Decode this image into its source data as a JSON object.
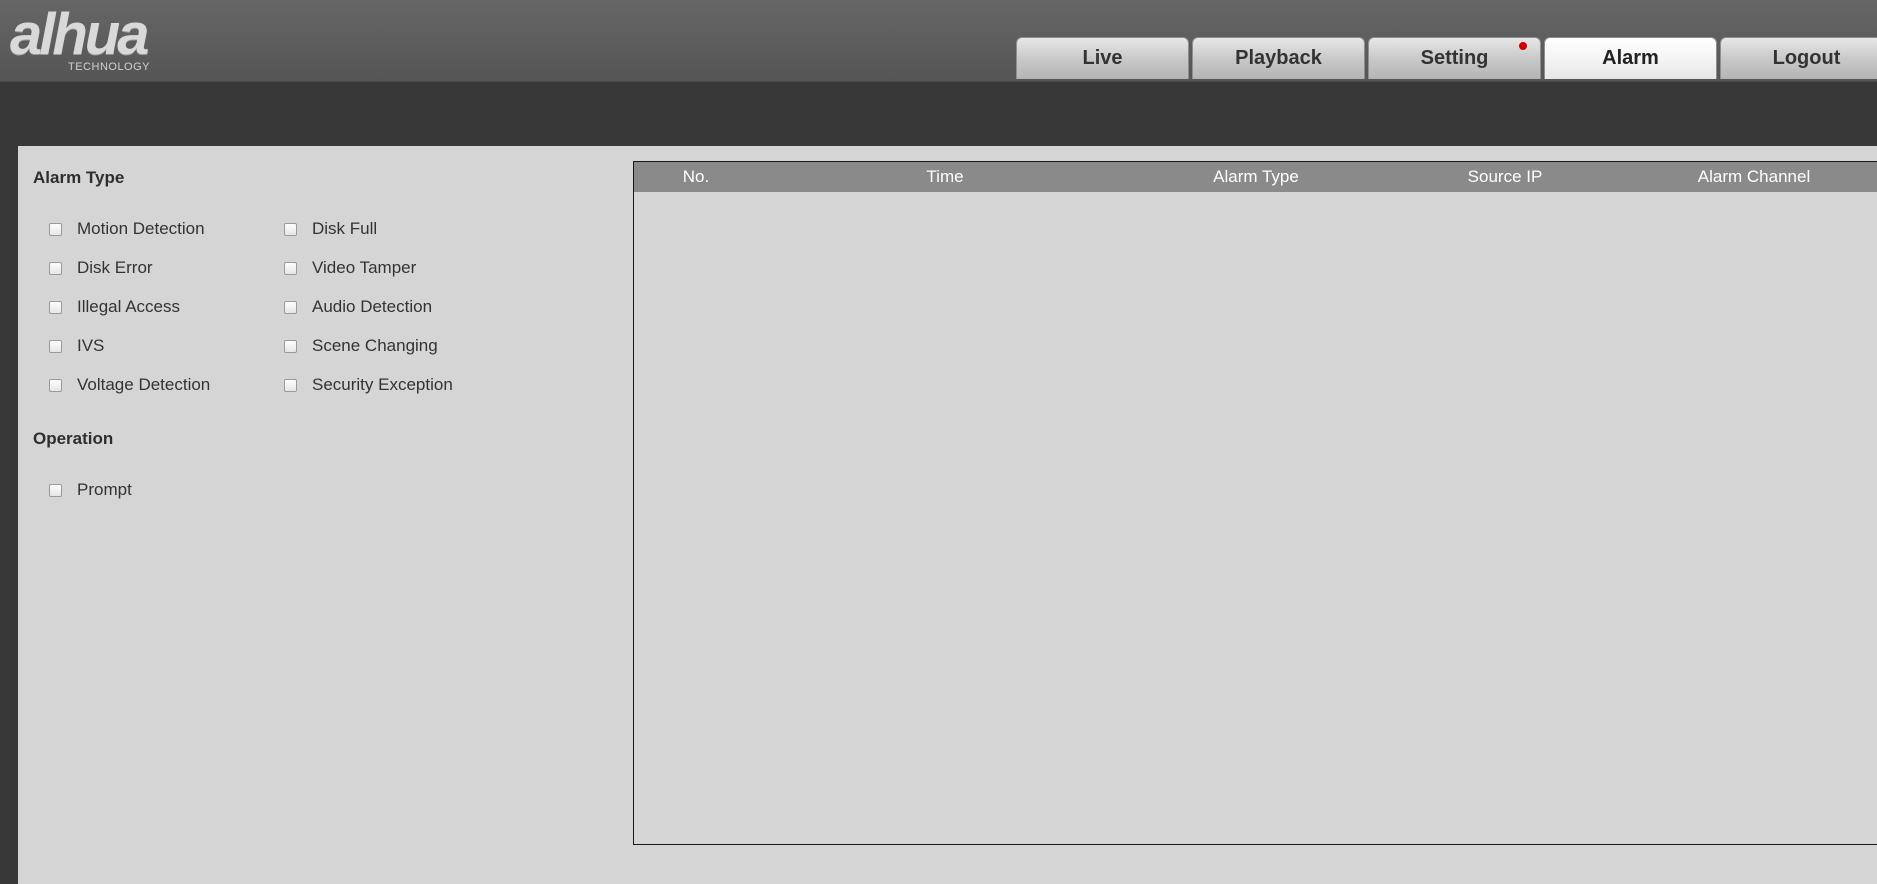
{
  "header": {
    "logo_text": "alhua",
    "logo_subtext": "TECHNOLOGY",
    "tabs": [
      {
        "label": "Live"
      },
      {
        "label": "Playback"
      },
      {
        "label": "Setting"
      },
      {
        "label": "Alarm"
      },
      {
        "label": "Logout"
      }
    ],
    "active_tab": "Alarm",
    "notification_color": "#d10000"
  },
  "sidebar": {
    "alarm_type_title": "Alarm Type",
    "alarm_types": [
      {
        "label": "Motion Detection",
        "checked": false
      },
      {
        "label": "Disk Full",
        "checked": false
      },
      {
        "label": "Disk Error",
        "checked": false
      },
      {
        "label": "Video Tamper",
        "checked": false
      },
      {
        "label": "Illegal Access",
        "checked": false
      },
      {
        "label": "Audio Detection",
        "checked": false
      },
      {
        "label": "IVS",
        "checked": false
      },
      {
        "label": "Scene Changing",
        "checked": false
      },
      {
        "label": "Voltage Detection",
        "checked": false
      },
      {
        "label": "Security Exception",
        "checked": false
      }
    ],
    "operation_title": "Operation",
    "operations": [
      {
        "label": "Prompt",
        "checked": false
      }
    ]
  },
  "table": {
    "columns": [
      "No.",
      "Time",
      "Alarm Type",
      "Source IP",
      "Alarm Channel"
    ],
    "rows": []
  },
  "colors": {
    "background": "#383838",
    "panel": "#d5d5d5",
    "table_header": "#8a8a8a"
  }
}
